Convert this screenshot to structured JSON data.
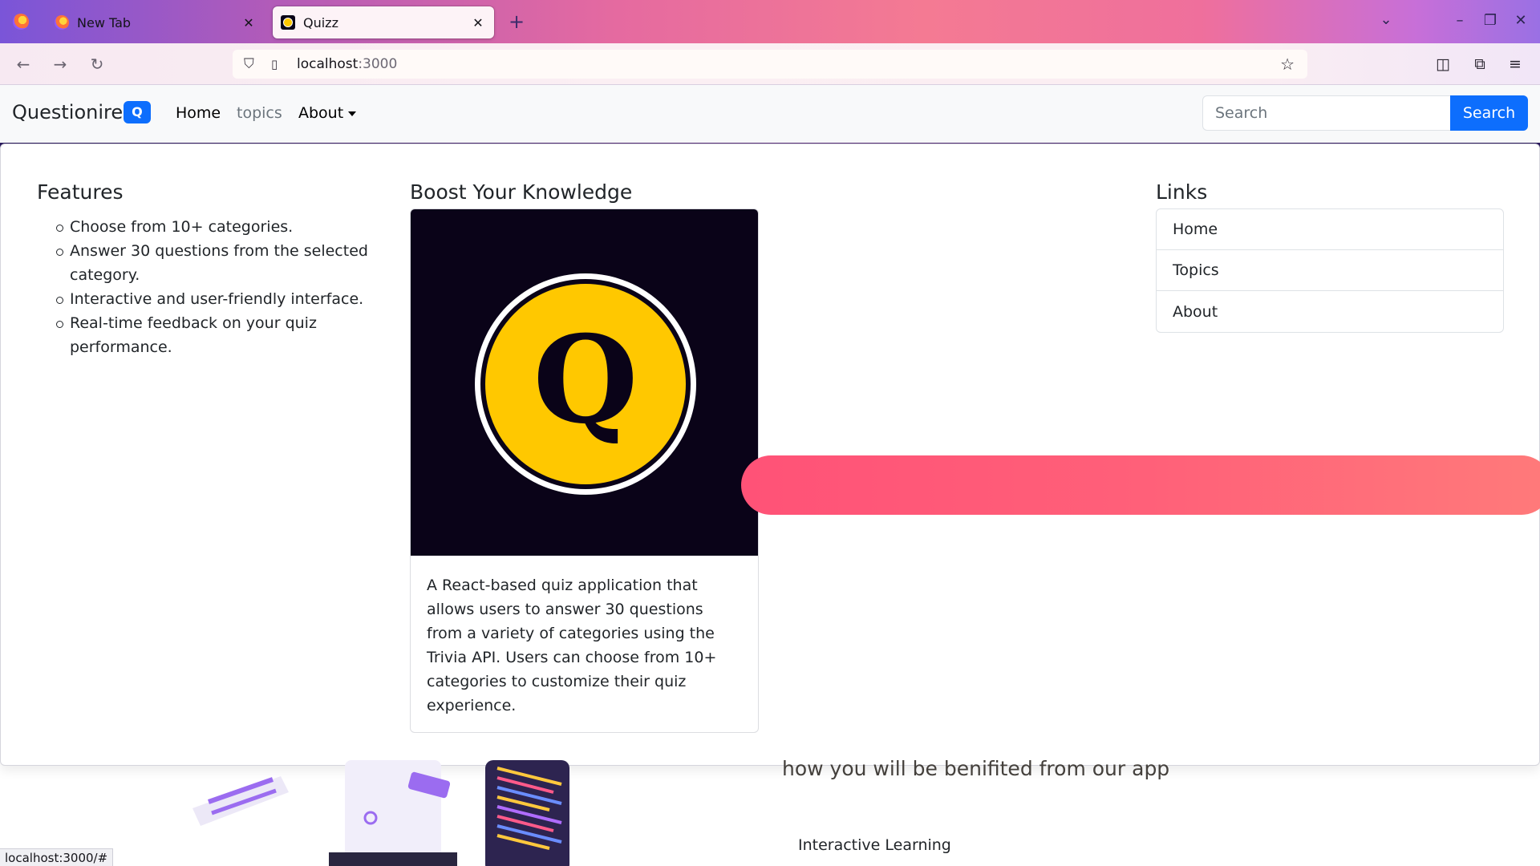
{
  "browser": {
    "tabs": [
      {
        "title": "New Tab",
        "active": false
      },
      {
        "title": "Quizz",
        "active": true
      }
    ],
    "url": {
      "host": "localhost",
      "port": ":3000"
    },
    "status_url": "localhost:3000/#",
    "colors": {
      "active_tab": "#fdf3f7",
      "toolbar": "#fbeff3"
    }
  },
  "site": {
    "brand": {
      "name": "Questionire",
      "badge": "Q"
    },
    "nav": {
      "home": "Home",
      "topics": "topics",
      "about": "About"
    },
    "search": {
      "placeholder": "Search",
      "button": "Search"
    },
    "colors": {
      "primary": "#0d6efd",
      "accent_pink": "#ff5277",
      "logo_yellow": "#ffc800"
    }
  },
  "mega_menu": {
    "features": {
      "heading": "Features",
      "items": [
        "Choose from 10+ categories.",
        "Answer 30 questions from the selected category.",
        "Interactive and user-friendly interface.",
        "Real-time feedback on your quiz performance."
      ]
    },
    "boost": {
      "heading": "Boost Your Knowledge",
      "logo_letter": "Q",
      "description": "A React-based quiz application that allows users to answer 30 questions from a variety of categories using the Trivia API. Users can choose from 10+ categories to customize their quiz experience."
    },
    "links": {
      "heading": "Links",
      "items": [
        "Home",
        "Topics",
        "About"
      ]
    }
  },
  "below": {
    "tagline": "how you will be benifited from our app",
    "subheading": "Interactive Learning"
  }
}
